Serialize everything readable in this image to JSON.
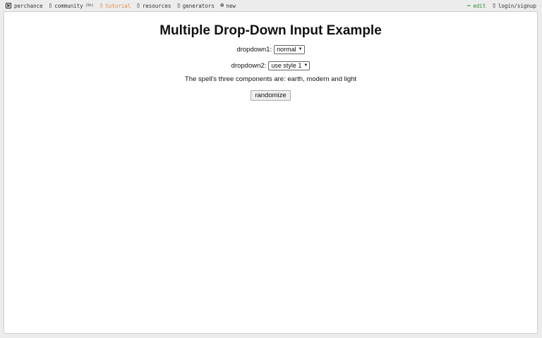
{
  "nav": {
    "brand": "perchance",
    "community": "community",
    "community_count": "(5h)",
    "tutorial": "tutorial",
    "resources": "resources",
    "generators": "generators",
    "new": "new",
    "edit": "edit",
    "login": "login/signup"
  },
  "page": {
    "title": "Multiple Drop-Down Input Example",
    "dropdown1_label": "dropdown1:",
    "dropdown1_value": "normal",
    "dropdown2_label": "dropdown2:",
    "dropdown2_value": "use style 1",
    "sentence": "The spell's three components are: earth, modern and light",
    "randomize_label": "randomize"
  },
  "colors": {
    "tutorial": "#e0883c",
    "edit": "#2e8b2e"
  }
}
